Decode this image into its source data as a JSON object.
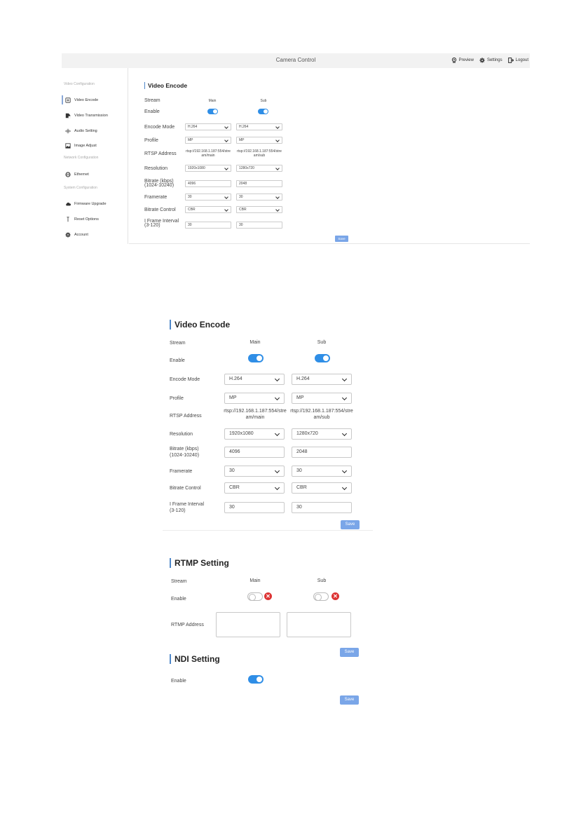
{
  "app": {
    "title": "Camera Control",
    "nav": [
      {
        "label": "Preview",
        "icon": "webcam-icon"
      },
      {
        "label": "Settings",
        "icon": "gear-icon"
      },
      {
        "label": "Logout",
        "icon": "logout-icon"
      }
    ]
  },
  "sidebar": {
    "sections": [
      "Video Configuration",
      "Network Configuration",
      "System Configuration"
    ],
    "items": [
      {
        "label": "Video Encode",
        "icon": "video-encode-icon"
      },
      {
        "label": "Video Transmission",
        "icon": "video-transmission-icon"
      },
      {
        "label": "Audio Setting",
        "icon": "audio-icon"
      },
      {
        "label": "Image Adjust",
        "icon": "image-icon"
      },
      {
        "label": "Ethernet",
        "icon": "globe-icon"
      },
      {
        "label": "Firmware Upgrade",
        "icon": "cloud-icon"
      },
      {
        "label": "Reset Options",
        "icon": "reset-icon"
      },
      {
        "label": "Account",
        "icon": "gear-icon"
      }
    ]
  },
  "video_encode": {
    "title": "Video Encode",
    "labels": {
      "stream": "Stream",
      "enable": "Enable",
      "encode_mode": "Encode Mode",
      "profile": "Profile",
      "rtsp_address": "RTSP Address",
      "resolution": "Resolution",
      "bitrate": "Bitrate (kbps)",
      "bitrate_range": "(1024-10240)",
      "framerate": "Framerate",
      "bitrate_control": "Bitrate Control",
      "iframe": "I Frame Interval",
      "iframe_range": "(3-120)"
    },
    "main": {
      "header": "Main",
      "enabled": true,
      "encode_mode": "H.264",
      "profile": "MP",
      "rtsp_line1": "rtsp://192.168.1.187:554/stre",
      "rtsp_line2": "am/main",
      "resolution": "1920x1080",
      "bitrate": "4096",
      "framerate": "30",
      "bitrate_control": "CBR",
      "iframe": "30"
    },
    "sub": {
      "header": "Sub",
      "enabled": true,
      "encode_mode": "H.264",
      "profile": "MP",
      "rtsp_line1": "rtsp://192.168.1.187:554/stre",
      "rtsp_line2": "am/sub",
      "resolution": "1280x720",
      "bitrate": "2048",
      "framerate": "30",
      "bitrate_control": "CBR",
      "iframe": "30"
    },
    "save_label": "Save"
  },
  "rtmp": {
    "title": "RTMP Setting",
    "stream_label": "Stream",
    "main_header": "Main",
    "sub_header": "Sub",
    "enable_label": "Enable",
    "main_enabled": false,
    "sub_enabled": false,
    "address_label": "RTMP Address",
    "main_address": "",
    "sub_address": "",
    "save_label": "Save"
  },
  "ndi": {
    "title": "NDI Setting",
    "enable_label": "Enable",
    "enabled": true,
    "save_label": "Save"
  },
  "colors": {
    "accent": "#2f8ee6",
    "button": "#7aa6e8",
    "error": "#dd3333"
  }
}
